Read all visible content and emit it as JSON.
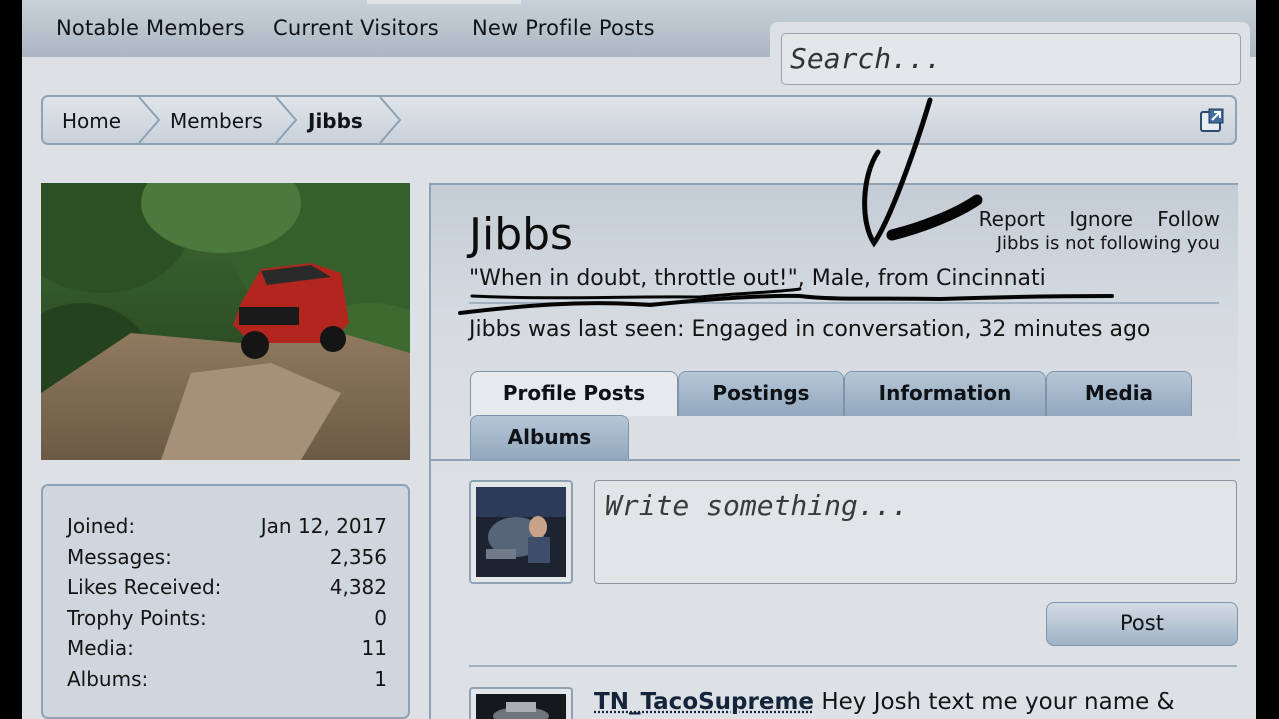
{
  "nav": {
    "items": [
      "Notable Members",
      "Current Visitors",
      "New Profile Posts"
    ]
  },
  "search": {
    "placeholder": "Search..."
  },
  "breadcrumb": {
    "items": [
      "Home",
      "Members",
      "Jibbs"
    ]
  },
  "profile": {
    "username": "Jibbs",
    "actions": [
      "Report",
      "Ignore",
      "Follow"
    ],
    "follow_status": "Jibbs is not following you",
    "tagline": "\"When in doubt, throttle out!\", Male, from Cincinnati",
    "last_seen": "Jibbs was last seen: Engaged in conversation, 32 minutes ago"
  },
  "tabs": [
    {
      "label": "Profile Posts",
      "active": true
    },
    {
      "label": "Postings",
      "active": false
    },
    {
      "label": "Information",
      "active": false
    },
    {
      "label": "Media",
      "active": false
    },
    {
      "label": "Albums",
      "active": false
    }
  ],
  "stats": [
    {
      "label": "Joined:",
      "value": "Jan 12, 2017"
    },
    {
      "label": "Messages:",
      "value": "2,356"
    },
    {
      "label": "Likes Received:",
      "value": "4,382"
    },
    {
      "label": "Trophy Points:",
      "value": "0"
    },
    {
      "label": "Media:",
      "value": "11"
    },
    {
      "label": "Albums:",
      "value": "1"
    }
  ],
  "composer": {
    "placeholder": "Write something...",
    "post_label": "Post"
  },
  "first_post": {
    "author": "TN_TacoSupreme",
    "text": " Hey Josh text me your name &"
  },
  "colors": {
    "panel_border": "#8fa2b4",
    "tab_fill": "#92a8be",
    "page_bg": "#dde1e5"
  }
}
